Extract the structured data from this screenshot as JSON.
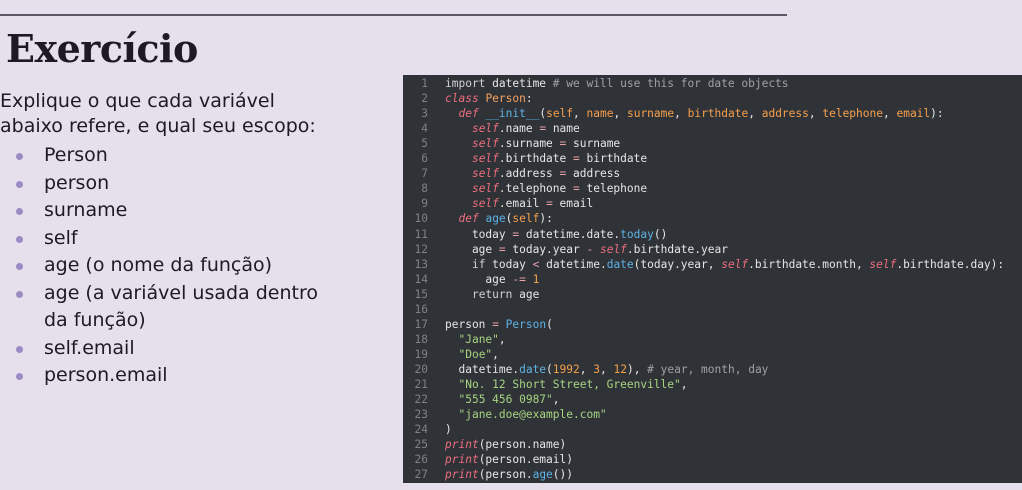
{
  "slide": {
    "title": "Exercício",
    "instructions": "Explique o que cada variável abaixo refere, e qual seu escopo:",
    "items": [
      "Person",
      "person",
      "surname",
      "self",
      "age (o nome da função)",
      "age (a variável usada dentro da função)",
      "self.email",
      "person.email"
    ]
  },
  "colors": {
    "background": "#e5e0ec",
    "bullet": "#9b8bc2",
    "code_background": "#2f3237"
  },
  "code": {
    "lines": [
      [
        [
          "kw",
          "import"
        ],
        [
          "plain",
          " datetime "
        ],
        [
          "cm",
          "# we will use this for date objects"
        ]
      ],
      [
        [
          "kwi",
          "class"
        ],
        [
          "plain",
          " "
        ],
        [
          "cls",
          "Person"
        ],
        [
          "plain",
          ":"
        ]
      ],
      [
        [
          "plain",
          "  "
        ],
        [
          "kwi",
          "def"
        ],
        [
          "plain",
          " "
        ],
        [
          "fn",
          "__init__"
        ],
        [
          "plain",
          "("
        ],
        [
          "param",
          "self"
        ],
        [
          "plain",
          ", "
        ],
        [
          "param",
          "name"
        ],
        [
          "plain",
          ", "
        ],
        [
          "param",
          "surname"
        ],
        [
          "plain",
          ", "
        ],
        [
          "param",
          "birthdate"
        ],
        [
          "plain",
          ", "
        ],
        [
          "param",
          "address"
        ],
        [
          "plain",
          ", "
        ],
        [
          "param",
          "telephone"
        ],
        [
          "plain",
          ", "
        ],
        [
          "param",
          "email"
        ],
        [
          "plain",
          "):"
        ]
      ],
      [
        [
          "plain",
          "    "
        ],
        [
          "self",
          "self"
        ],
        [
          "plain",
          ".name "
        ],
        [
          "op",
          "="
        ],
        [
          "plain",
          " name"
        ]
      ],
      [
        [
          "plain",
          "    "
        ],
        [
          "self",
          "self"
        ],
        [
          "plain",
          ".surname "
        ],
        [
          "op",
          "="
        ],
        [
          "plain",
          " surname"
        ]
      ],
      [
        [
          "plain",
          "    "
        ],
        [
          "self",
          "self"
        ],
        [
          "plain",
          ".birthdate "
        ],
        [
          "op",
          "="
        ],
        [
          "plain",
          " birthdate"
        ]
      ],
      [
        [
          "plain",
          "    "
        ],
        [
          "self",
          "self"
        ],
        [
          "plain",
          ".address "
        ],
        [
          "op",
          "="
        ],
        [
          "plain",
          " address"
        ]
      ],
      [
        [
          "plain",
          "    "
        ],
        [
          "self",
          "self"
        ],
        [
          "plain",
          ".telephone "
        ],
        [
          "op",
          "="
        ],
        [
          "plain",
          " telephone"
        ]
      ],
      [
        [
          "plain",
          "    "
        ],
        [
          "self",
          "self"
        ],
        [
          "plain",
          ".email "
        ],
        [
          "op",
          "="
        ],
        [
          "plain",
          " email"
        ]
      ],
      [
        [
          "plain",
          "  "
        ],
        [
          "kwi",
          "def"
        ],
        [
          "plain",
          " "
        ],
        [
          "fn",
          "age"
        ],
        [
          "plain",
          "("
        ],
        [
          "param",
          "self"
        ],
        [
          "plain",
          "):"
        ]
      ],
      [
        [
          "plain",
          "    today "
        ],
        [
          "op",
          "="
        ],
        [
          "plain",
          " datetime.date."
        ],
        [
          "fn",
          "today"
        ],
        [
          "plain",
          "()"
        ]
      ],
      [
        [
          "plain",
          "    age "
        ],
        [
          "op",
          "="
        ],
        [
          "plain",
          " today.year "
        ],
        [
          "op",
          "-"
        ],
        [
          "plain",
          " "
        ],
        [
          "self",
          "self"
        ],
        [
          "plain",
          ".birthdate.year"
        ]
      ],
      [
        [
          "plain",
          "    "
        ],
        [
          "kw",
          "if"
        ],
        [
          "plain",
          " today "
        ],
        [
          "op",
          "<"
        ],
        [
          "plain",
          " datetime."
        ],
        [
          "fn",
          "date"
        ],
        [
          "plain",
          "(today.year, "
        ],
        [
          "self",
          "self"
        ],
        [
          "plain",
          ".birthdate.month, "
        ],
        [
          "self",
          "self"
        ],
        [
          "plain",
          ".birthdate.day):"
        ]
      ],
      [
        [
          "plain",
          "      age "
        ],
        [
          "op",
          "-="
        ],
        [
          "plain",
          " "
        ],
        [
          "num",
          "1"
        ]
      ],
      [
        [
          "plain",
          "    "
        ],
        [
          "kw",
          "return"
        ],
        [
          "plain",
          " age"
        ]
      ],
      [],
      [
        [
          "plain",
          "person "
        ],
        [
          "op",
          "="
        ],
        [
          "plain",
          " "
        ],
        [
          "fn",
          "Person"
        ],
        [
          "plain",
          "("
        ]
      ],
      [
        [
          "plain",
          "  "
        ],
        [
          "str",
          "\"Jane\""
        ],
        [
          "plain",
          ","
        ]
      ],
      [
        [
          "plain",
          "  "
        ],
        [
          "str",
          "\"Doe\""
        ],
        [
          "plain",
          ","
        ]
      ],
      [
        [
          "plain",
          "  datetime."
        ],
        [
          "fn",
          "date"
        ],
        [
          "plain",
          "("
        ],
        [
          "num",
          "1992"
        ],
        [
          "plain",
          ", "
        ],
        [
          "num",
          "3"
        ],
        [
          "plain",
          ", "
        ],
        [
          "num",
          "12"
        ],
        [
          "plain",
          "), "
        ],
        [
          "cm",
          "# year, month, day"
        ]
      ],
      [
        [
          "plain",
          "  "
        ],
        [
          "str",
          "\"No. 12 Short Street, Greenville\""
        ],
        [
          "plain",
          ","
        ]
      ],
      [
        [
          "plain",
          "  "
        ],
        [
          "str",
          "\"555 456 0987\""
        ],
        [
          "plain",
          ","
        ]
      ],
      [
        [
          "plain",
          "  "
        ],
        [
          "str",
          "\"jane.doe@example.com\""
        ]
      ],
      [
        [
          "plain",
          ")"
        ]
      ],
      [
        [
          "kwi",
          "print"
        ],
        [
          "plain",
          "(person.name)"
        ]
      ],
      [
        [
          "kwi",
          "print"
        ],
        [
          "plain",
          "(person.email)"
        ]
      ],
      [
        [
          "kwi",
          "print"
        ],
        [
          "plain",
          "(person."
        ],
        [
          "fn",
          "age"
        ],
        [
          "plain",
          "())"
        ]
      ]
    ]
  }
}
